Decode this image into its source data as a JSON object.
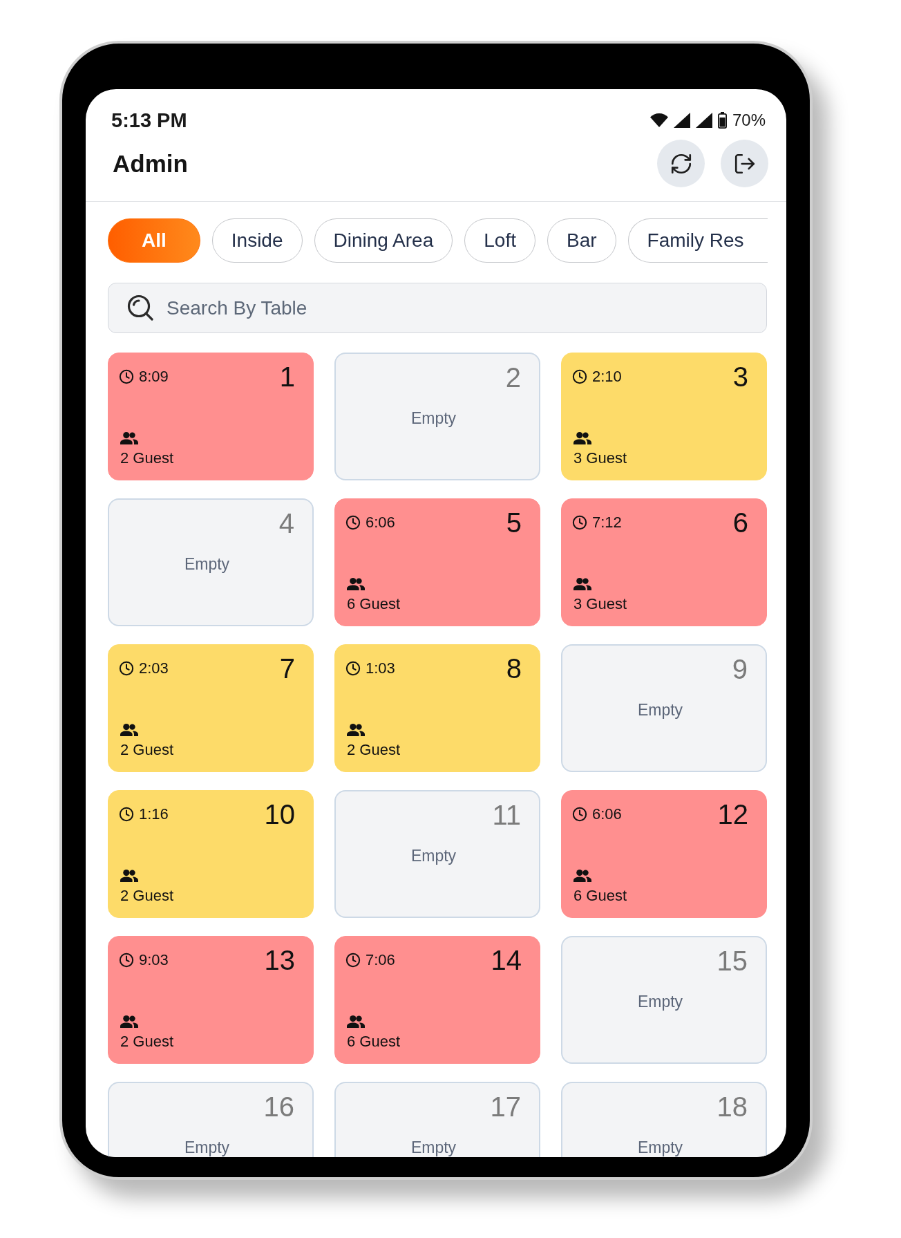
{
  "status_bar": {
    "time": "5:13 PM",
    "battery": "70%"
  },
  "header": {
    "title": "Admin"
  },
  "filters": [
    {
      "label": "All",
      "selected": true
    },
    {
      "label": "Inside",
      "selected": false
    },
    {
      "label": "Dining Area",
      "selected": false
    },
    {
      "label": "Loft",
      "selected": false
    },
    {
      "label": "Bar",
      "selected": false
    },
    {
      "label": "Family Res",
      "selected": false
    }
  ],
  "search": {
    "placeholder": "Search By Table"
  },
  "tables": [
    {
      "number": "1",
      "kind": "occupied",
      "color": "#ff8f8f",
      "time": "8:09",
      "guests": "2 Guest"
    },
    {
      "number": "2",
      "kind": "empty",
      "status": "Empty"
    },
    {
      "number": "3",
      "kind": "occupied",
      "color": "#fddb69",
      "time": "2:10",
      "guests": "3 Guest"
    },
    {
      "number": "4",
      "kind": "empty",
      "status": "Empty"
    },
    {
      "number": "5",
      "kind": "occupied",
      "color": "#ff8f8f",
      "time": "6:06",
      "guests": "6 Guest"
    },
    {
      "number": "6",
      "kind": "occupied",
      "color": "#ff8f8f",
      "time": "7:12",
      "guests": "3 Guest"
    },
    {
      "number": "7",
      "kind": "occupied",
      "color": "#fddb69",
      "time": "2:03",
      "guests": "2 Guest"
    },
    {
      "number": "8",
      "kind": "occupied",
      "color": "#fddb69",
      "time": "1:03",
      "guests": "2 Guest"
    },
    {
      "number": "9",
      "kind": "empty",
      "status": "Empty"
    },
    {
      "number": "10",
      "kind": "occupied",
      "color": "#fddb69",
      "time": "1:16",
      "guests": "2 Guest"
    },
    {
      "number": "11",
      "kind": "empty",
      "status": "Empty"
    },
    {
      "number": "12",
      "kind": "occupied",
      "color": "#ff8f8f",
      "time": "6:06",
      "guests": "6 Guest"
    },
    {
      "number": "13",
      "kind": "occupied",
      "color": "#ff8f8f",
      "time": "9:03",
      "guests": "2 Guest"
    },
    {
      "number": "14",
      "kind": "occupied",
      "color": "#ff8f8f",
      "time": "7:06",
      "guests": "6 Guest"
    },
    {
      "number": "15",
      "kind": "empty",
      "status": "Empty"
    },
    {
      "number": "16",
      "kind": "empty",
      "status": "Empty"
    },
    {
      "number": "17",
      "kind": "empty",
      "status": "Empty"
    },
    {
      "number": "18",
      "kind": "empty",
      "status": "Empty"
    }
  ]
}
